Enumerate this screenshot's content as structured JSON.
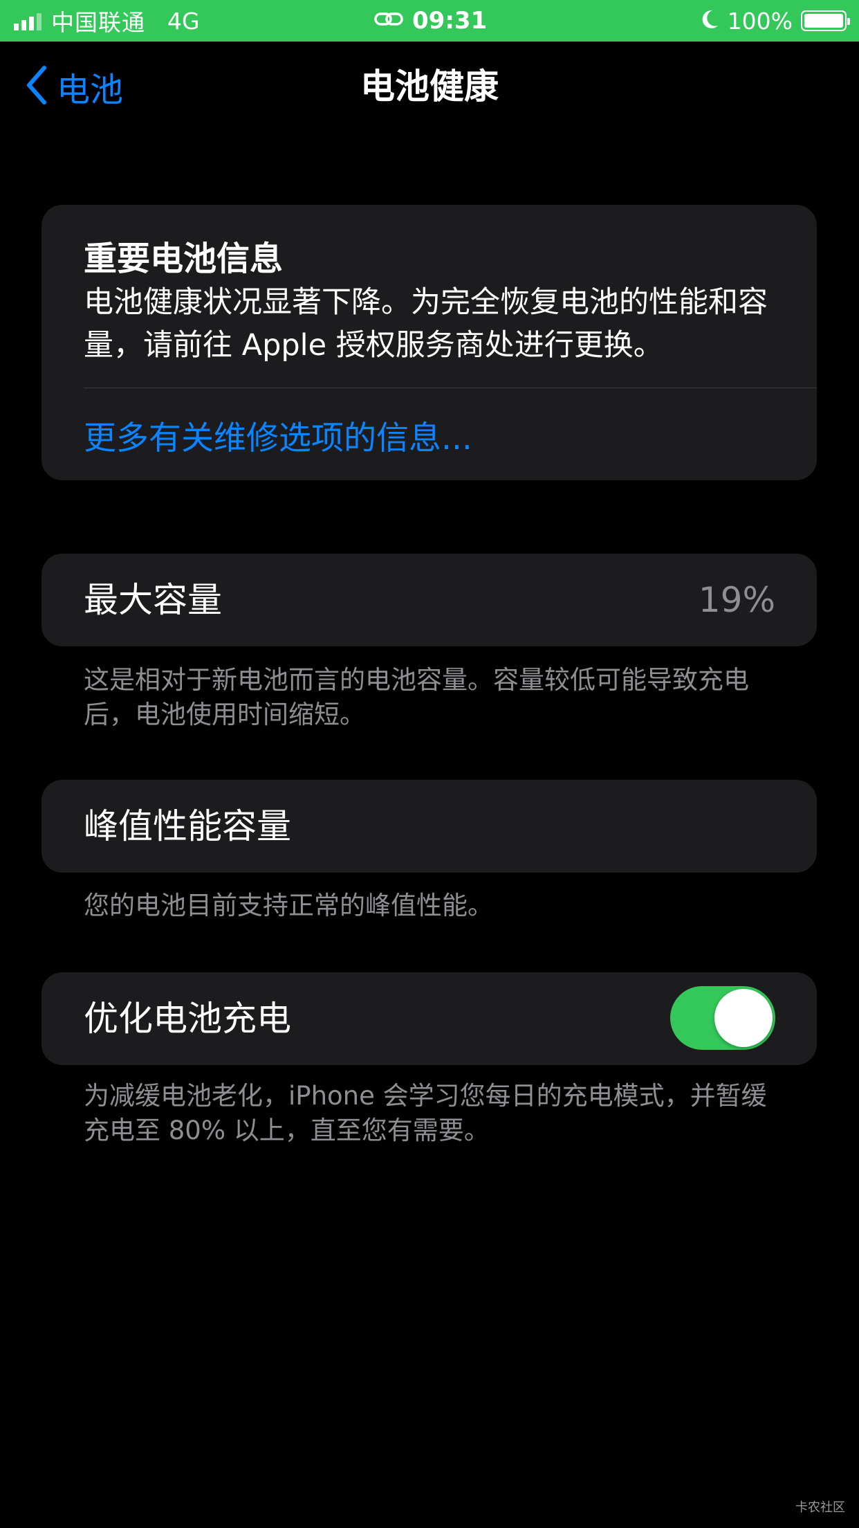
{
  "status_bar": {
    "carrier": "中国联通",
    "network": "4G",
    "time": "09:31",
    "battery_percent": "100%",
    "background_color": "#34c759",
    "icons": [
      "signal-icon",
      "link-icon",
      "moon-icon",
      "battery-icon"
    ]
  },
  "nav": {
    "back_label": "电池",
    "title": "电池健康"
  },
  "important": {
    "title": "重要电池信息",
    "body": "电池健康状况显著下降。为完全恢复电池的性能和容量，请前往 Apple 授权服务商处进行更换。",
    "link": "更多有关维修选项的信息..."
  },
  "max_capacity": {
    "label": "最大容量",
    "value": "19%",
    "footnote": "这是相对于新电池而言的电池容量。容量较低可能导致充电后，电池使用时间缩短。"
  },
  "peak_performance": {
    "label": "峰值性能容量",
    "footnote": "您的电池目前支持正常的峰值性能。"
  },
  "optimized_charging": {
    "label": "优化电池充电",
    "enabled": true,
    "footnote": "为减缓电池老化，iPhone 会学习您每日的充电模式，并暂缓充电至 80% 以上，直至您有需要。"
  },
  "watermark": "卡农社区",
  "colors": {
    "accent": "#0a84ff",
    "toggle_on": "#34c759",
    "card": "#1c1c1e",
    "secondary_text": "#8e8e93"
  }
}
